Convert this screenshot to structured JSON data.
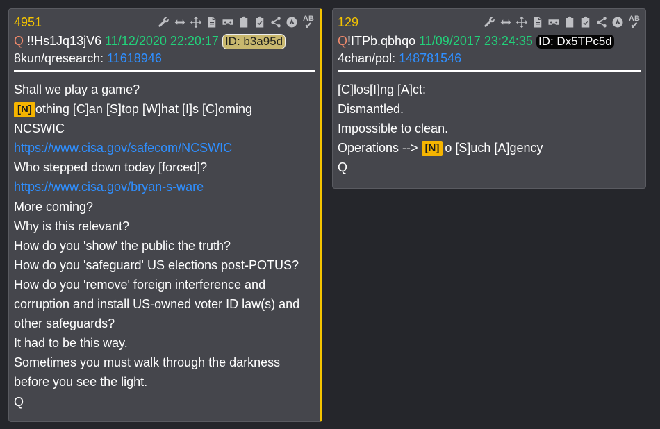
{
  "post1": {
    "number": "4951",
    "author": "Q",
    "tripcode": "!!Hs1Jq13jV6",
    "datetime": "11/12/2020 22:20:17",
    "id": "ID: b3a95d",
    "board": "8kun/qresearch:",
    "post_ref": "11618946",
    "lines": [
      "Shall we play a game?",
      {
        "badge": "[N]",
        "text": "othing [C]an [S]top [W]hat [I]s [C]oming"
      },
      "NCSWIC",
      {
        "link": "https://www.cisa.gov/safecom/NCSWIC"
      },
      "Who stepped down today [forced]?",
      {
        "link": "https://www.cisa.gov/bryan-s-ware"
      },
      "More coming?",
      "Why is this relevant?",
      "How do you 'show' the public the truth?",
      "How do you 'safeguard' US elections post-POTUS?",
      "How do you 'remove' foreign interference and",
      "corruption and install US-owned voter ID law(s) and",
      "other safeguards?",
      "It had to be this way.",
      "Sometimes you must walk through the darkness",
      "before you see the light.",
      "Q"
    ]
  },
  "post2": {
    "number": "129",
    "author": "Q",
    "tripcode": "!ITPb.qbhqo",
    "datetime": "11/09/2017 23:24:35",
    "id": "ID: Dx5TPc5d",
    "board": "4chan/pol:",
    "post_ref": "148781546",
    "lines": [
      "[C]los[I]ng [A]ct:",
      "Dismantled.",
      "Impossible to clean.",
      {
        "prefix": "Operations --> ",
        "badge": "[N]",
        "text": "o [S]uch [A]gency"
      },
      "Q"
    ]
  },
  "toolbar": {
    "icons": [
      "wrench-icon",
      "resize-horizontal-icon",
      "move-icon",
      "document-icon",
      "vr-icon",
      "clipboard-icon",
      "clipboard-check-icon",
      "share-icon",
      "navigate-up-icon",
      "spellcheck-icon"
    ],
    "spellcheck_glyph": "AB"
  },
  "colors": {
    "background": "#25262b",
    "card": "#45464c",
    "accent": "#f5c400",
    "date": "#22d17a",
    "link": "#2f8fff",
    "author": "#f08a6c"
  }
}
